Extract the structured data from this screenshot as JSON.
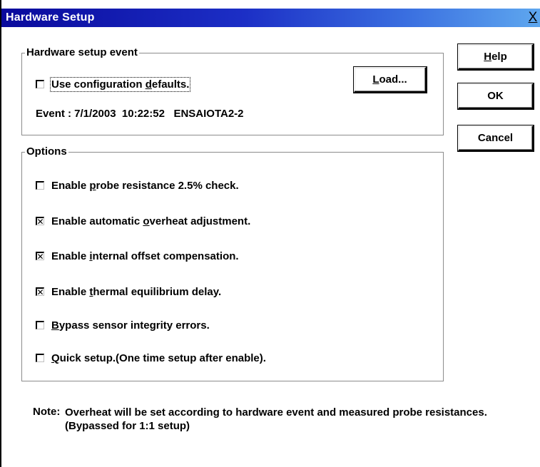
{
  "window": {
    "title": "Hardware Setup",
    "close_glyph": "X"
  },
  "hardware_group": {
    "legend": "Hardware setup event",
    "use_defaults": {
      "label_pre": "Use configuration ",
      "label_mnemonic": "d",
      "label_post": "efaults.",
      "checked": false
    },
    "event_text": "Event : 7/1/2003  10:22:52   ENSAIOTA2-2",
    "load_button": {
      "mnemonic": "L",
      "rest": "oad..."
    }
  },
  "options_group": {
    "legend": "Options",
    "items": [
      {
        "pre": "Enable ",
        "mnemonic": "p",
        "post": "robe resistance 2.5% check.",
        "checked": false
      },
      {
        "pre": "Enable automatic ",
        "mnemonic": "o",
        "post": "verheat adjustment.",
        "checked": true
      },
      {
        "pre": "Enable ",
        "mnemonic": "i",
        "post": "nternal offset compensation.",
        "checked": true
      },
      {
        "pre": "Enable ",
        "mnemonic": "t",
        "post": "hermal equilibrium delay.",
        "checked": true
      },
      {
        "pre": "",
        "mnemonic": "B",
        "post": "ypass sensor integrity errors.",
        "checked": false
      },
      {
        "pre": "",
        "mnemonic": "Q",
        "post": "uick setup.(One time setup after enable).",
        "checked": false
      }
    ]
  },
  "buttons": {
    "help": {
      "mnemonic": "H",
      "rest": "elp"
    },
    "ok": {
      "label": "OK"
    },
    "cancel": {
      "label": "Cancel"
    }
  },
  "note": {
    "label": "Note:",
    "text": "Overheat will be set according to hardware event and measured probe resistances.(Bypassed for 1:1 setup)"
  },
  "check_glyph": "✕"
}
